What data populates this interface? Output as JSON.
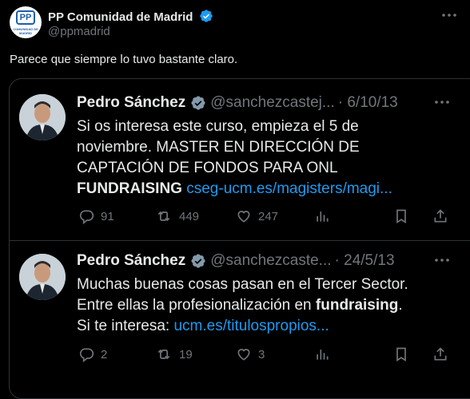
{
  "header": {
    "author_name": "PP Comunidad de Madrid",
    "author_handle": "@ppmadrid",
    "logo_mark": "PP",
    "logo_sub": "COMUNIDAD DE MADRID",
    "tweet_text": "Parece que siempre lo tuvo bastante claro."
  },
  "quoted": [
    {
      "name": "Pedro Sánchez",
      "handle": "@sanchezcastej...",
      "date": "· 6/10/13",
      "lines": [
        "Si os interesa este curso, empieza el 5 de",
        "noviembre. MASTER EN DIRECCIÓN DE",
        "CAPTACIÓN DE FONDOS PARA ONL"
      ],
      "last_bold": "FUNDRAISING",
      "last_link": "cseg-ucm.es/magisters/magi...",
      "replies": "91",
      "retweets": "449",
      "likes": "247"
    },
    {
      "name": "Pedro Sánchez",
      "handle": "@sanchezcaste...",
      "date": "· 24/5/13",
      "line1": "Muchas buenas cosas pasan en el Tercer Sector.",
      "line2_pre": "Entre ellas la profesionalización en ",
      "line2_bold": "fundraising",
      "line2_post": ".",
      "line3_pre": "Si te interesa: ",
      "line3_link": "ucm.es/titulospropios...",
      "replies": "2",
      "retweets": "19",
      "likes": "3"
    }
  ],
  "colors": {
    "background": "#000000",
    "text": "#e7e9ea",
    "muted": "#71767b",
    "link": "#1d9bf0",
    "verified_blue": "#1d9bf0",
    "verified_grey": "#829aab",
    "border": "#2f3336"
  },
  "icons": [
    "verified-badge-icon",
    "more-icon",
    "reply-icon",
    "retweet-icon",
    "like-icon",
    "views-icon",
    "bookmark-icon",
    "share-icon"
  ]
}
